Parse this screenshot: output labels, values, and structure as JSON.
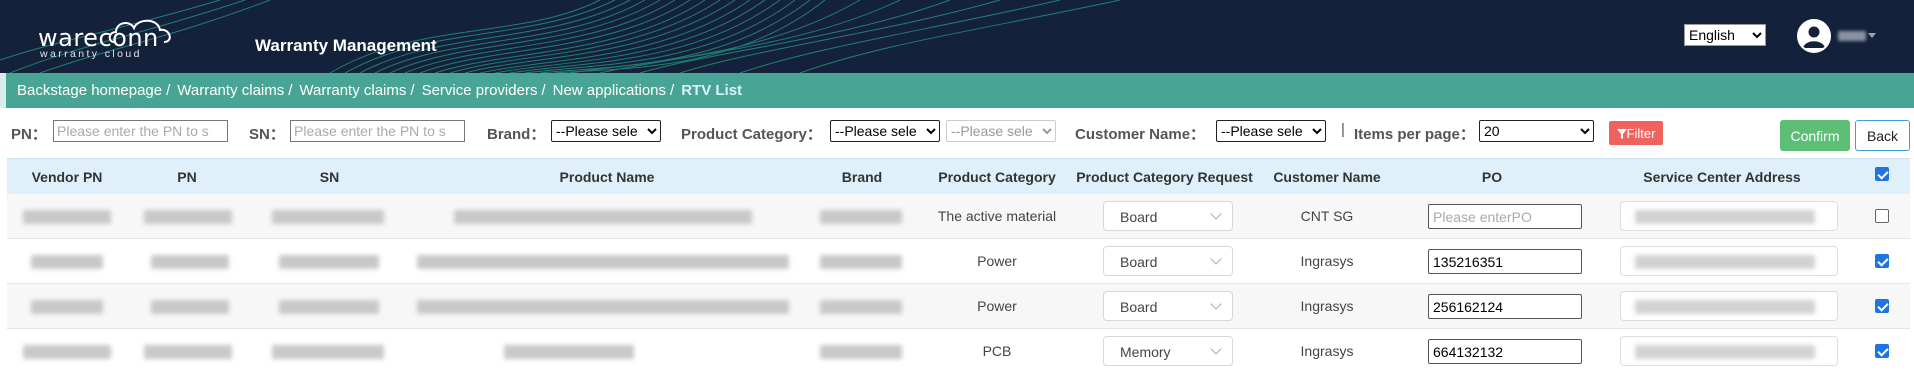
{
  "header": {
    "logo_text": "wareconn",
    "logo_subtext": "warranty cloud",
    "app_title": "Warranty Management",
    "language": "English",
    "bg_color": "#14213a",
    "accent_wave_color": "#2fc9a8"
  },
  "breadcrumb": {
    "items": [
      "Backstage homepage",
      "Warranty claims",
      "Warranty claims",
      "Service providers",
      "New applications",
      "RTV List"
    ],
    "separator": "/",
    "bg_color": "#48a596"
  },
  "filters": {
    "pn_label": "PN：",
    "pn_placeholder": "Please enter the PN to s",
    "sn_label": "SN：",
    "sn_placeholder": "Please enter the PN to s",
    "brand_label": "Brand：",
    "brand_value": "--Please sele",
    "category_label": "Product Category：",
    "category_value": "--Please sele",
    "subcategory_value": "--Please sele",
    "customer_label": "Customer Name：",
    "customer_value": "--Please sele",
    "separator": "|",
    "items_per_page_label": "Items per page：",
    "items_per_page_value": "20",
    "filter_button": "Filter",
    "confirm_button": "Confirm",
    "back_button": "Back"
  },
  "table": {
    "columns": [
      "Vendor PN",
      "PN",
      "SN",
      "Product Name",
      "Brand",
      "Product Category",
      "Product Category Request",
      "Customer Name",
      "PO",
      "Service Center Address"
    ],
    "header_checked": true,
    "rows": [
      {
        "category": "The active material",
        "request": "Board",
        "customer": "CNT SG",
        "po": "",
        "po_placeholder": "Please enterPO",
        "checked": false
      },
      {
        "category": "Power",
        "request": "Board",
        "customer": "Ingrasys",
        "po": "135216351",
        "po_placeholder": "",
        "checked": true
      },
      {
        "category": "Power",
        "request": "Board",
        "customer": "Ingrasys",
        "po": "256162124",
        "po_placeholder": "",
        "checked": true
      },
      {
        "category": "PCB",
        "request": "Memory",
        "customer": "Ingrasys",
        "po": "664132132",
        "po_placeholder": "",
        "checked": true
      }
    ]
  }
}
